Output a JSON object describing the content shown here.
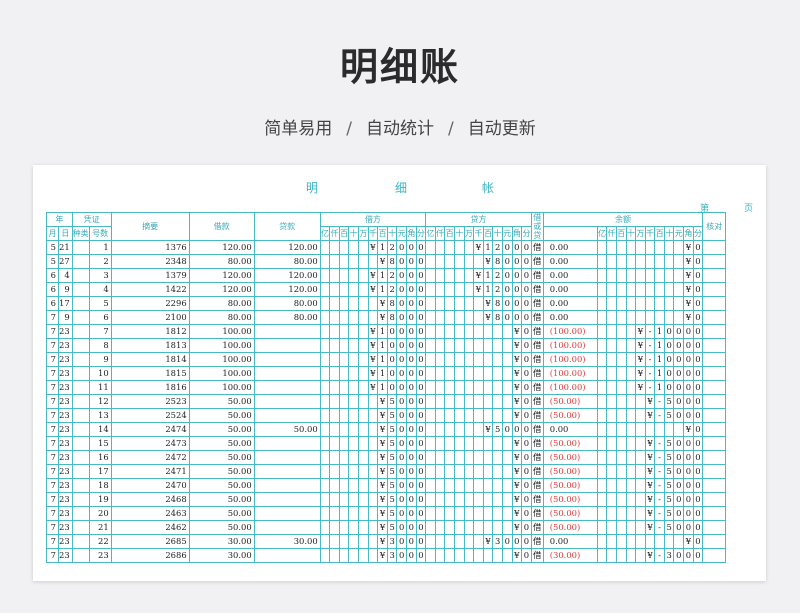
{
  "page": {
    "title": "明细账",
    "tags": [
      "简单易用",
      "自动统计",
      "自动更新"
    ]
  },
  "sheet": {
    "title_chars": [
      "明",
      "细",
      "帐"
    ],
    "page_label_1": "第",
    "page_label_2": "页",
    "headers": {
      "year": "年",
      "voucher": "凭证",
      "month": "月",
      "day": "日",
      "kind": "种类",
      "number": "号数",
      "summary": "摘要",
      "debit": "借款",
      "credit": "贷款",
      "debit_side": "借方",
      "credit_side": "贷方",
      "dir": "借或贷",
      "balance": "余额",
      "check": "核对",
      "digit_labels": [
        "亿",
        "仟",
        "百",
        "十",
        "万",
        "千",
        "百",
        "十",
        "元",
        "角",
        "分"
      ]
    },
    "rows": [
      {
        "m": "5",
        "d": "21",
        "no": "1",
        "sum": "1376",
        "debit": "120.00",
        "credit": "120.00",
        "dd": [
          "",
          "",
          "",
          "",
          "",
          "¥",
          "1",
          "2",
          "0",
          "0",
          "0"
        ],
        "cd": [
          "",
          "",
          "",
          "",
          "",
          "¥",
          "1",
          "2",
          "0",
          "0",
          "0"
        ],
        "dir": "借",
        "bal": "0.00",
        "bd": [
          "",
          "",
          "",
          "",
          "",
          "",
          "",
          "",
          "",
          "¥",
          "0"
        ],
        "neg": false
      },
      {
        "m": "5",
        "d": "27",
        "no": "2",
        "sum": "2348",
        "debit": "80.00",
        "credit": "80.00",
        "dd": [
          "",
          "",
          "",
          "",
          "",
          "",
          "¥",
          "8",
          "0",
          "0",
          "0"
        ],
        "cd": [
          "",
          "",
          "",
          "",
          "",
          "",
          "¥",
          "8",
          "0",
          "0",
          "0"
        ],
        "dir": "借",
        "bal": "0.00",
        "bd": [
          "",
          "",
          "",
          "",
          "",
          "",
          "",
          "",
          "",
          "¥",
          "0"
        ],
        "neg": false
      },
      {
        "m": "6",
        "d": "4",
        "no": "3",
        "sum": "1379",
        "debit": "120.00",
        "credit": "120.00",
        "dd": [
          "",
          "",
          "",
          "",
          "",
          "¥",
          "1",
          "2",
          "0",
          "0",
          "0"
        ],
        "cd": [
          "",
          "",
          "",
          "",
          "",
          "¥",
          "1",
          "2",
          "0",
          "0",
          "0"
        ],
        "dir": "借",
        "bal": "0.00",
        "bd": [
          "",
          "",
          "",
          "",
          "",
          "",
          "",
          "",
          "",
          "¥",
          "0"
        ],
        "neg": false
      },
      {
        "m": "6",
        "d": "9",
        "no": "4",
        "sum": "1422",
        "debit": "120.00",
        "credit": "120.00",
        "dd": [
          "",
          "",
          "",
          "",
          "",
          "¥",
          "1",
          "2",
          "0",
          "0",
          "0"
        ],
        "cd": [
          "",
          "",
          "",
          "",
          "",
          "¥",
          "1",
          "2",
          "0",
          "0",
          "0"
        ],
        "dir": "借",
        "bal": "0.00",
        "bd": [
          "",
          "",
          "",
          "",
          "",
          "",
          "",
          "",
          "",
          "¥",
          "0"
        ],
        "neg": false
      },
      {
        "m": "6",
        "d": "17",
        "no": "5",
        "sum": "2296",
        "debit": "80.00",
        "credit": "80.00",
        "dd": [
          "",
          "",
          "",
          "",
          "",
          "",
          "¥",
          "8",
          "0",
          "0",
          "0"
        ],
        "cd": [
          "",
          "",
          "",
          "",
          "",
          "",
          "¥",
          "8",
          "0",
          "0",
          "0"
        ],
        "dir": "借",
        "bal": "0.00",
        "bd": [
          "",
          "",
          "",
          "",
          "",
          "",
          "",
          "",
          "",
          "¥",
          "0"
        ],
        "neg": false
      },
      {
        "m": "7",
        "d": "9",
        "no": "6",
        "sum": "2100",
        "debit": "80.00",
        "credit": "80.00",
        "dd": [
          "",
          "",
          "",
          "",
          "",
          "",
          "¥",
          "8",
          "0",
          "0",
          "0"
        ],
        "cd": [
          "",
          "",
          "",
          "",
          "",
          "",
          "¥",
          "8",
          "0",
          "0",
          "0"
        ],
        "dir": "借",
        "bal": "0.00",
        "bd": [
          "",
          "",
          "",
          "",
          "",
          "",
          "",
          "",
          "",
          "¥",
          "0"
        ],
        "neg": false
      },
      {
        "m": "7",
        "d": "23",
        "no": "7",
        "sum": "1812",
        "debit": "100.00",
        "credit": "",
        "dd": [
          "",
          "",
          "",
          "",
          "",
          "¥",
          "1",
          "0",
          "0",
          "0",
          "0"
        ],
        "cd": [
          "",
          "",
          "",
          "",
          "",
          "",
          "",
          "",
          "",
          "¥",
          "0"
        ],
        "dir": "借",
        "bal": "(100.00)",
        "bd": [
          "",
          "",
          "",
          "",
          "¥",
          "-",
          "1",
          "0",
          "0",
          "0",
          "0"
        ],
        "neg": true
      },
      {
        "m": "7",
        "d": "23",
        "no": "8",
        "sum": "1813",
        "debit": "100.00",
        "credit": "",
        "dd": [
          "",
          "",
          "",
          "",
          "",
          "¥",
          "1",
          "0",
          "0",
          "0",
          "0"
        ],
        "cd": [
          "",
          "",
          "",
          "",
          "",
          "",
          "",
          "",
          "",
          "¥",
          "0"
        ],
        "dir": "借",
        "bal": "(100.00)",
        "bd": [
          "",
          "",
          "",
          "",
          "¥",
          "-",
          "1",
          "0",
          "0",
          "0",
          "0"
        ],
        "neg": true
      },
      {
        "m": "7",
        "d": "23",
        "no": "9",
        "sum": "1814",
        "debit": "100.00",
        "credit": "",
        "dd": [
          "",
          "",
          "",
          "",
          "",
          "¥",
          "1",
          "0",
          "0",
          "0",
          "0"
        ],
        "cd": [
          "",
          "",
          "",
          "",
          "",
          "",
          "",
          "",
          "",
          "¥",
          "0"
        ],
        "dir": "借",
        "bal": "(100.00)",
        "bd": [
          "",
          "",
          "",
          "",
          "¥",
          "-",
          "1",
          "0",
          "0",
          "0",
          "0"
        ],
        "neg": true
      },
      {
        "m": "7",
        "d": "23",
        "no": "10",
        "sum": "1815",
        "debit": "100.00",
        "credit": "",
        "dd": [
          "",
          "",
          "",
          "",
          "",
          "¥",
          "1",
          "0",
          "0",
          "0",
          "0"
        ],
        "cd": [
          "",
          "",
          "",
          "",
          "",
          "",
          "",
          "",
          "",
          "¥",
          "0"
        ],
        "dir": "借",
        "bal": "(100.00)",
        "bd": [
          "",
          "",
          "",
          "",
          "¥",
          "-",
          "1",
          "0",
          "0",
          "0",
          "0"
        ],
        "neg": true
      },
      {
        "m": "7",
        "d": "23",
        "no": "11",
        "sum": "1816",
        "debit": "100.00",
        "credit": "",
        "dd": [
          "",
          "",
          "",
          "",
          "",
          "¥",
          "1",
          "0",
          "0",
          "0",
          "0"
        ],
        "cd": [
          "",
          "",
          "",
          "",
          "",
          "",
          "",
          "",
          "",
          "¥",
          "0"
        ],
        "dir": "借",
        "bal": "(100.00)",
        "bd": [
          "",
          "",
          "",
          "",
          "¥",
          "-",
          "1",
          "0",
          "0",
          "0",
          "0"
        ],
        "neg": true
      },
      {
        "m": "7",
        "d": "23",
        "no": "12",
        "sum": "2523",
        "debit": "50.00",
        "credit": "",
        "dd": [
          "",
          "",
          "",
          "",
          "",
          "",
          "¥",
          "5",
          "0",
          "0",
          "0"
        ],
        "cd": [
          "",
          "",
          "",
          "",
          "",
          "",
          "",
          "",
          "",
          "¥",
          "0"
        ],
        "dir": "借",
        "bal": "(50.00)",
        "bd": [
          "",
          "",
          "",
          "",
          "",
          "¥",
          "-",
          "5",
          "0",
          "0",
          "0"
        ],
        "neg": true
      },
      {
        "m": "7",
        "d": "23",
        "no": "13",
        "sum": "2524",
        "debit": "50.00",
        "credit": "",
        "dd": [
          "",
          "",
          "",
          "",
          "",
          "",
          "¥",
          "5",
          "0",
          "0",
          "0"
        ],
        "cd": [
          "",
          "",
          "",
          "",
          "",
          "",
          "",
          "",
          "",
          "¥",
          "0"
        ],
        "dir": "借",
        "bal": "(50.00)",
        "bd": [
          "",
          "",
          "",
          "",
          "",
          "¥",
          "-",
          "5",
          "0",
          "0",
          "0"
        ],
        "neg": true
      },
      {
        "m": "7",
        "d": "23",
        "no": "14",
        "sum": "2474",
        "debit": "50.00",
        "credit": "50.00",
        "dd": [
          "",
          "",
          "",
          "",
          "",
          "",
          "¥",
          "5",
          "0",
          "0",
          "0"
        ],
        "cd": [
          "",
          "",
          "",
          "",
          "",
          "",
          "¥",
          "5",
          "0",
          "0",
          "0"
        ],
        "dir": "借",
        "bal": "0.00",
        "bd": [
          "",
          "",
          "",
          "",
          "",
          "",
          "",
          "",
          "",
          "¥",
          "0"
        ],
        "neg": false
      },
      {
        "m": "7",
        "d": "23",
        "no": "15",
        "sum": "2473",
        "debit": "50.00",
        "credit": "",
        "dd": [
          "",
          "",
          "",
          "",
          "",
          "",
          "¥",
          "5",
          "0",
          "0",
          "0"
        ],
        "cd": [
          "",
          "",
          "",
          "",
          "",
          "",
          "",
          "",
          "",
          "¥",
          "0"
        ],
        "dir": "借",
        "bal": "(50.00)",
        "bd": [
          "",
          "",
          "",
          "",
          "",
          "¥",
          "-",
          "5",
          "0",
          "0",
          "0"
        ],
        "neg": true
      },
      {
        "m": "7",
        "d": "23",
        "no": "16",
        "sum": "2472",
        "debit": "50.00",
        "credit": "",
        "dd": [
          "",
          "",
          "",
          "",
          "",
          "",
          "¥",
          "5",
          "0",
          "0",
          "0"
        ],
        "cd": [
          "",
          "",
          "",
          "",
          "",
          "",
          "",
          "",
          "",
          "¥",
          "0"
        ],
        "dir": "借",
        "bal": "(50.00)",
        "bd": [
          "",
          "",
          "",
          "",
          "",
          "¥",
          "-",
          "5",
          "0",
          "0",
          "0"
        ],
        "neg": true
      },
      {
        "m": "7",
        "d": "23",
        "no": "17",
        "sum": "2471",
        "debit": "50.00",
        "credit": "",
        "dd": [
          "",
          "",
          "",
          "",
          "",
          "",
          "¥",
          "5",
          "0",
          "0",
          "0"
        ],
        "cd": [
          "",
          "",
          "",
          "",
          "",
          "",
          "",
          "",
          "",
          "¥",
          "0"
        ],
        "dir": "借",
        "bal": "(50.00)",
        "bd": [
          "",
          "",
          "",
          "",
          "",
          "¥",
          "-",
          "5",
          "0",
          "0",
          "0"
        ],
        "neg": true
      },
      {
        "m": "7",
        "d": "23",
        "no": "18",
        "sum": "2470",
        "debit": "50.00",
        "credit": "",
        "dd": [
          "",
          "",
          "",
          "",
          "",
          "",
          "¥",
          "5",
          "0",
          "0",
          "0"
        ],
        "cd": [
          "",
          "",
          "",
          "",
          "",
          "",
          "",
          "",
          "",
          "¥",
          "0"
        ],
        "dir": "借",
        "bal": "(50.00)",
        "bd": [
          "",
          "",
          "",
          "",
          "",
          "¥",
          "-",
          "5",
          "0",
          "0",
          "0"
        ],
        "neg": true
      },
      {
        "m": "7",
        "d": "23",
        "no": "19",
        "sum": "2468",
        "debit": "50.00",
        "credit": "",
        "dd": [
          "",
          "",
          "",
          "",
          "",
          "",
          "¥",
          "5",
          "0",
          "0",
          "0"
        ],
        "cd": [
          "",
          "",
          "",
          "",
          "",
          "",
          "",
          "",
          "",
          "¥",
          "0"
        ],
        "dir": "借",
        "bal": "(50.00)",
        "bd": [
          "",
          "",
          "",
          "",
          "",
          "¥",
          "-",
          "5",
          "0",
          "0",
          "0"
        ],
        "neg": true
      },
      {
        "m": "7",
        "d": "23",
        "no": "20",
        "sum": "2463",
        "debit": "50.00",
        "credit": "",
        "dd": [
          "",
          "",
          "",
          "",
          "",
          "",
          "¥",
          "5",
          "0",
          "0",
          "0"
        ],
        "cd": [
          "",
          "",
          "",
          "",
          "",
          "",
          "",
          "",
          "",
          "¥",
          "0"
        ],
        "dir": "借",
        "bal": "(50.00)",
        "bd": [
          "",
          "",
          "",
          "",
          "",
          "¥",
          "-",
          "5",
          "0",
          "0",
          "0"
        ],
        "neg": true
      },
      {
        "m": "7",
        "d": "23",
        "no": "21",
        "sum": "2462",
        "debit": "50.00",
        "credit": "",
        "dd": [
          "",
          "",
          "",
          "",
          "",
          "",
          "¥",
          "5",
          "0",
          "0",
          "0"
        ],
        "cd": [
          "",
          "",
          "",
          "",
          "",
          "",
          "",
          "",
          "",
          "¥",
          "0"
        ],
        "dir": "借",
        "bal": "(50.00)",
        "bd": [
          "",
          "",
          "",
          "",
          "",
          "¥",
          "-",
          "5",
          "0",
          "0",
          "0"
        ],
        "neg": true
      },
      {
        "m": "7",
        "d": "23",
        "no": "22",
        "sum": "2685",
        "debit": "30.00",
        "credit": "30.00",
        "dd": [
          "",
          "",
          "",
          "",
          "",
          "",
          "¥",
          "3",
          "0",
          "0",
          "0"
        ],
        "cd": [
          "",
          "",
          "",
          "",
          "",
          "",
          "¥",
          "3",
          "0",
          "0",
          "0"
        ],
        "dir": "借",
        "bal": "0.00",
        "bd": [
          "",
          "",
          "",
          "",
          "",
          "",
          "",
          "",
          "",
          "¥",
          "0"
        ],
        "neg": false
      },
      {
        "m": "7",
        "d": "23",
        "no": "23",
        "sum": "2686",
        "debit": "30.00",
        "credit": "",
        "dd": [
          "",
          "",
          "",
          "",
          "",
          "",
          "¥",
          "3",
          "0",
          "0",
          "0"
        ],
        "cd": [
          "",
          "",
          "",
          "",
          "",
          "",
          "",
          "",
          "",
          "¥",
          "0"
        ],
        "dir": "借",
        "bal": "(30.00)",
        "bd": [
          "",
          "",
          "",
          "",
          "",
          "¥",
          "-",
          "3",
          "0",
          "0",
          "0"
        ],
        "neg": true
      }
    ]
  },
  "colors": {
    "grid": "#46b9c4",
    "header_text": "#3aaab8",
    "negative": "#e03a3a"
  }
}
